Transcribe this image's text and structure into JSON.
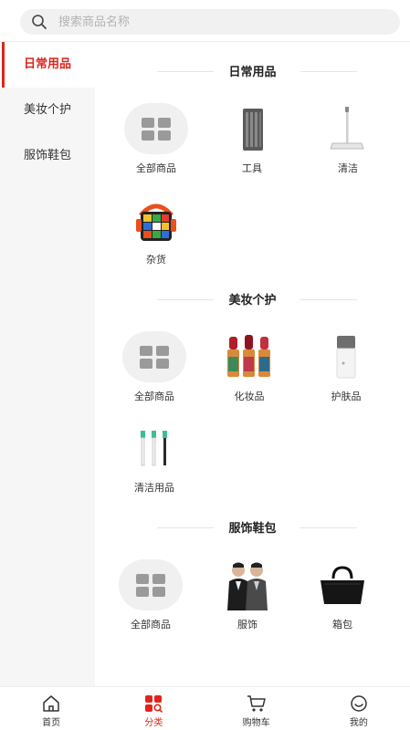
{
  "search": {
    "placeholder": "搜索商品名称"
  },
  "sidebar": {
    "items": [
      {
        "label": "日常用品"
      },
      {
        "label": "美妆个护"
      },
      {
        "label": "服饰鞋包"
      }
    ]
  },
  "sections": [
    {
      "title": "日常用品",
      "items": [
        {
          "label": "全部商品",
          "icon": "grid-icon"
        },
        {
          "label": "工具",
          "icon": "tool-kit-icon"
        },
        {
          "label": "清洁",
          "icon": "mop-icon"
        },
        {
          "label": "杂货",
          "icon": "rubik-cube-speaker-icon"
        }
      ]
    },
    {
      "title": "美妆个护",
      "items": [
        {
          "label": "全部商品",
          "icon": "grid-icon"
        },
        {
          "label": "化妆品",
          "icon": "lipstick-icon"
        },
        {
          "label": "护肤品",
          "icon": "skincare-bottle-icon"
        },
        {
          "label": "清洁用品",
          "icon": "toothbrush-heads-icon"
        }
      ]
    },
    {
      "title": "服饰鞋包",
      "items": [
        {
          "label": "全部商品",
          "icon": "grid-icon"
        },
        {
          "label": "服饰",
          "icon": "clothing-models-icon"
        },
        {
          "label": "箱包",
          "icon": "handbag-icon"
        }
      ]
    }
  ],
  "tabbar": {
    "items": [
      {
        "label": "首页",
        "icon": "home-icon"
      },
      {
        "label": "分类",
        "icon": "category-icon"
      },
      {
        "label": "购物车",
        "icon": "cart-icon"
      },
      {
        "label": "我的",
        "icon": "profile-icon"
      }
    ]
  },
  "colors": {
    "accent": "#e0241b",
    "sidebar_bg": "#f6f6f6",
    "divider": "#eeeeee"
  }
}
